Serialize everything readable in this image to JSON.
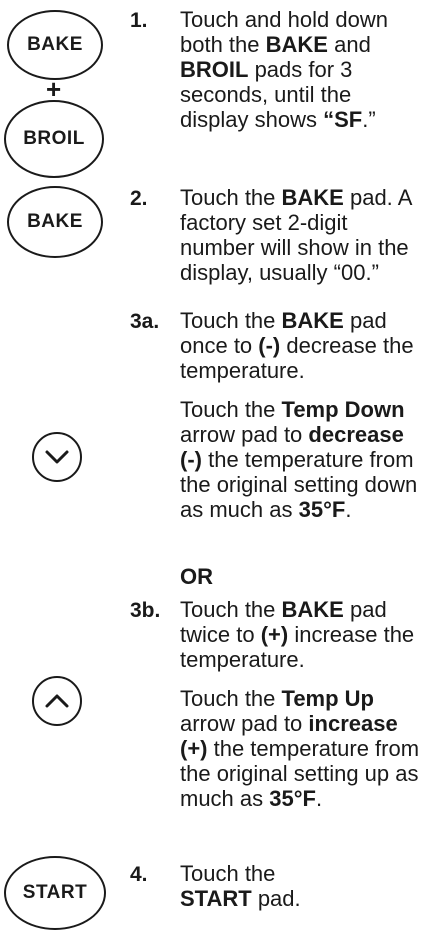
{
  "pads": {
    "bake1": "BAKE",
    "plus": "+",
    "broil": "BROIL",
    "bake2": "BAKE",
    "start": "START"
  },
  "icons": {
    "down": "chevron-down-icon",
    "up": "chevron-up-icon"
  },
  "steps": {
    "s1": {
      "num": "1.",
      "p1": "Touch and hold down both the ",
      "b1": "BAKE",
      "p2": " and ",
      "b2": "BROIL",
      "p3": " pads for 3 seconds, until the display shows ",
      "b3": "“SF",
      "p4": ".”"
    },
    "s2": {
      "num": "2.",
      "p1": "Touch the ",
      "b1": "BAKE",
      "p2": " pad. A factory set 2-digit number will show in the display, usually “00.”"
    },
    "s3a": {
      "num": "3a.",
      "p1": "Touch the ",
      "b1": "BAKE",
      "p2": " pad once to ",
      "b2": "(-)",
      "p3": " decrease the temperature."
    },
    "s3a_arrow": {
      "p1": "Touch the ",
      "b1": "Temp Down",
      "p2": " arrow pad to ",
      "b2": "decrease (-)",
      "p3": " the temperature from the original setting down as much as ",
      "b3": "35°F",
      "p4": "."
    },
    "or": "OR",
    "s3b": {
      "num": "3b.",
      "p1": "Touch the ",
      "b1": "BAKE",
      "p2": " pad twice to ",
      "b2": "(+)",
      "p3": " increase the temperature."
    },
    "s3b_arrow": {
      "p1": "Touch the ",
      "b1": "Temp Up",
      "p2": " arrow pad to ",
      "b2": "increase (+)",
      "p3": " the temperature from the original setting up as much as ",
      "b3": "35°F",
      "p4": "."
    },
    "s4": {
      "num": "4.",
      "p1": "Touch the ",
      "b1": "START",
      "p2": " pad."
    }
  }
}
